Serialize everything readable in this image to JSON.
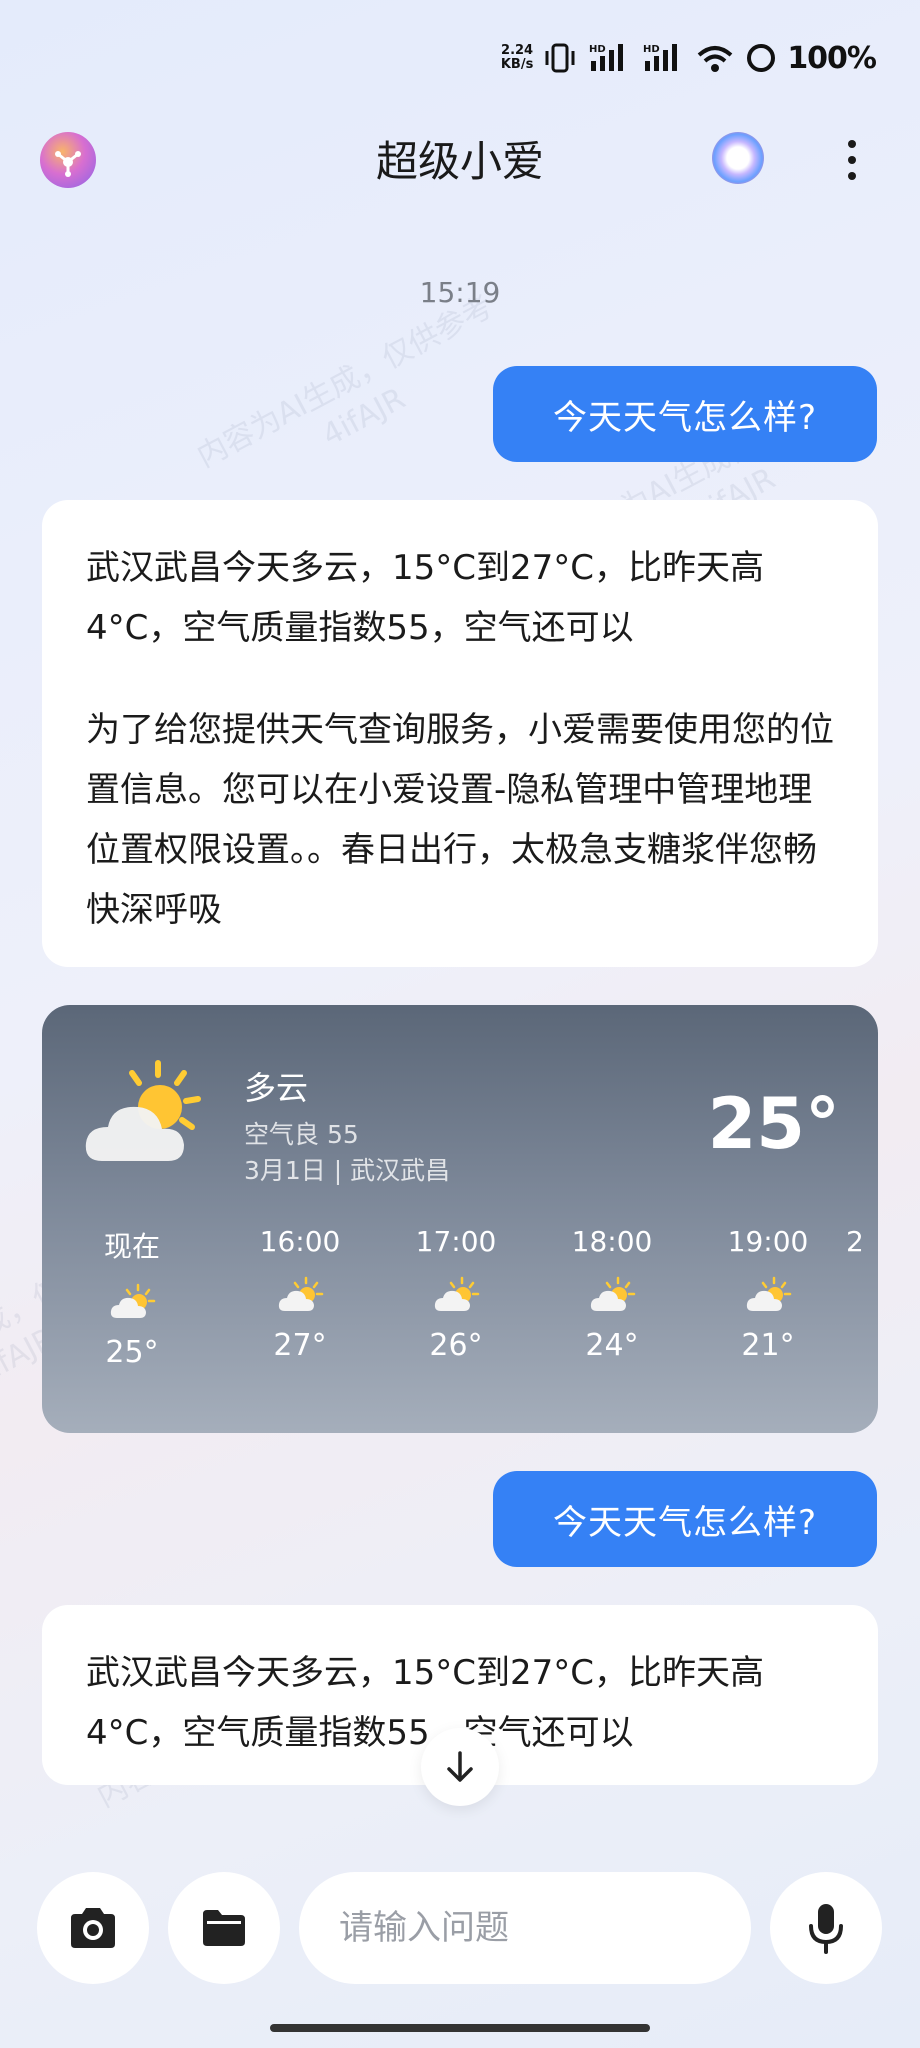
{
  "status_bar": {
    "speed_value": "2.24",
    "speed_unit": "KB/s",
    "battery": "100%"
  },
  "header": {
    "title": "超级小爱"
  },
  "chat": {
    "timestamp": "15:19",
    "user_message_1": "今天天气怎么样?",
    "ai_reply_1": {
      "paragraph_1": "武汉武昌今天多云，15°C到27°C，比昨天高4°C，空气质量指数55，空气还可以",
      "paragraph_2": "为了给您提供天气查询服务，小爱需要使用您的位置信息。您可以在小爱设置-隐私管理中管理地理位置权限设置。。春日出行，太极急支糖浆伴您畅快深呼吸"
    },
    "user_message_2": "今天天气怎么样?",
    "ai_reply_2": {
      "paragraph_1": "武汉武昌今天多云，15°C到27°C，比昨天高4°C，空气质量指数55，空气还可以"
    }
  },
  "weather_card": {
    "condition": "多云",
    "air_quality": "空气良 55",
    "date_location": "3月1日 | 武汉武昌",
    "current_temp": "25°",
    "hourly": [
      {
        "time": "现在",
        "temp": "25°",
        "icon": "partly-cloudy-icon"
      },
      {
        "time": "16:00",
        "temp": "27°",
        "icon": "partly-cloudy-icon"
      },
      {
        "time": "17:00",
        "temp": "26°",
        "icon": "partly-cloudy-icon"
      },
      {
        "time": "18:00",
        "temp": "24°",
        "icon": "partly-cloudy-icon"
      },
      {
        "time": "19:00",
        "temp": "21°",
        "icon": "partly-cloudy-icon"
      },
      {
        "time": "2",
        "temp": "",
        "icon": ""
      }
    ]
  },
  "input_bar": {
    "placeholder": "请输入问题"
  },
  "watermark": {
    "line_1": "内容为AI生成，仅供参考",
    "line_2": "4ifAJR"
  },
  "colors": {
    "user_bubble": "#3581f5",
    "card_top": "#5b6778",
    "card_bottom": "#a5aebb"
  }
}
